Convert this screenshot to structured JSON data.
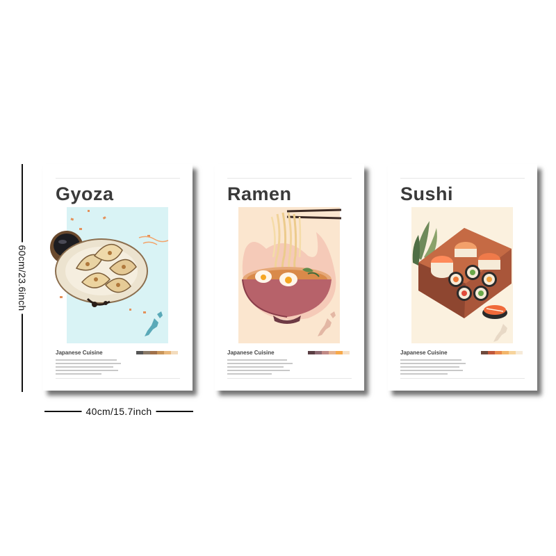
{
  "dimensions": {
    "height_label": "60cm/23.6inch",
    "width_label": "40cm/15.7inch"
  },
  "posters": [
    {
      "title": "Gyoza",
      "subtitle": "Japanese Cuisine",
      "art_icon": "gyoza-plate-illustration",
      "background": "#d9f3f5",
      "palette": [
        "#555555",
        "#8a7a68",
        "#a0714a",
        "#c8955a",
        "#e9b87c",
        "#f3dcbd"
      ]
    },
    {
      "title": "Ramen",
      "subtitle": "Japanese Cuisine",
      "art_icon": "ramen-bowl-illustration",
      "background": "#fbe6cf",
      "palette": [
        "#5a3f44",
        "#8e6a72",
        "#c08a86",
        "#e5b392",
        "#f7a94b",
        "#f6e0c6"
      ]
    },
    {
      "title": "Sushi",
      "subtitle": "Japanese Cuisine",
      "art_icon": "sushi-box-illustration",
      "background": "#fbf1df",
      "palette": [
        "#6e4a3d",
        "#c0583b",
        "#e98a4d",
        "#f3b66b",
        "#f7d49c",
        "#f6ead8"
      ]
    }
  ]
}
